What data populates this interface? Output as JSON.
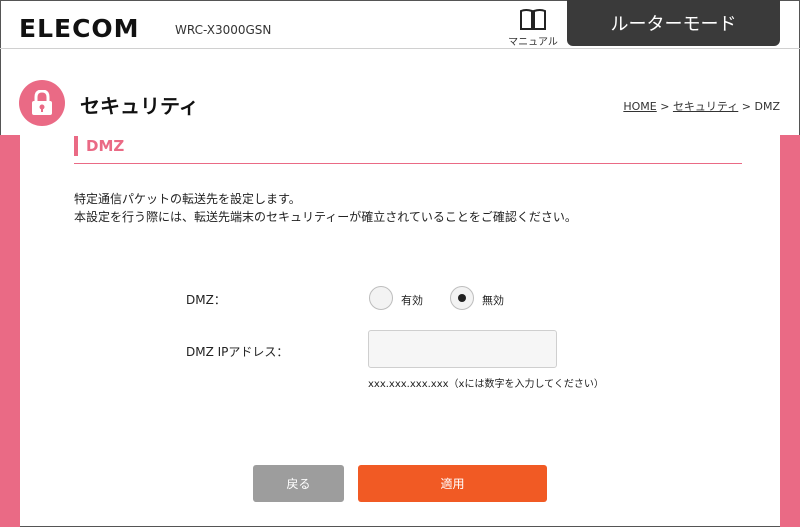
{
  "header": {
    "logo": "ELECOM",
    "model": "WRC-X3000GSN",
    "manual_label": "マニュアル",
    "mode_label": "ルーターモード"
  },
  "page": {
    "title": "セキュリティ",
    "breadcrumb": {
      "home": "HOME",
      "sep1": " > ",
      "security": "セキュリティ",
      "sep2": " > ",
      "current": "DMZ"
    }
  },
  "section": {
    "title": "DMZ",
    "description_line1": "特定通信パケットの転送先を設定します。",
    "description_line2": "本設定を行う際には、転送先端末のセキュリティーが確立されていることをご確認ください。"
  },
  "form": {
    "dmz_label": "DMZ：",
    "enable_label": "有効",
    "disable_label": "無効",
    "selected": "無効",
    "ip_label": "DMZ IPアドレス：",
    "ip_value": "",
    "ip_hint": "xxx.xxx.xxx.xxx（xには数字を入力してください）"
  },
  "buttons": {
    "back": "戻る",
    "apply": "適用"
  },
  "colors": {
    "accent_pink": "#ea6a85",
    "apply_orange": "#f15a24",
    "back_gray": "#9d9d9d",
    "mode_tab_dark": "#3a3a3a"
  }
}
